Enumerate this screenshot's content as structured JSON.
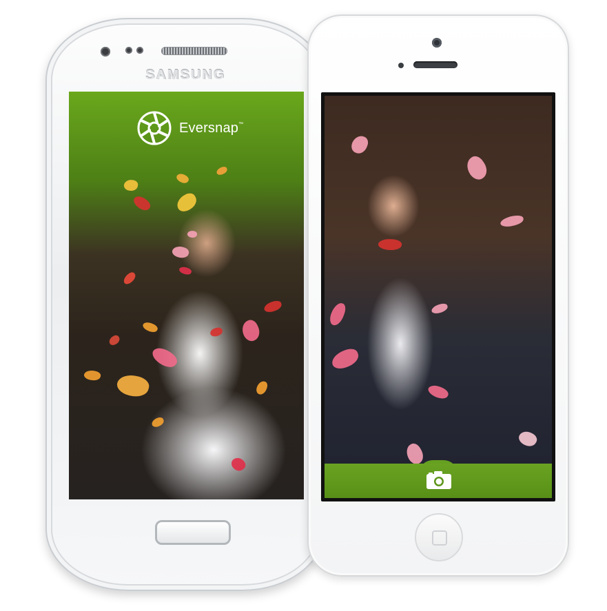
{
  "samsung_phone": {
    "brand_label": "SAMSUNG"
  },
  "android_app": {
    "logo_text": "Eversnap",
    "logo_trademark": "™"
  },
  "ios_app": {
    "camera_icon": "camera-icon"
  },
  "colors": {
    "accent_green": "#6aa322",
    "petal_pink": "#f06a8a",
    "petal_red": "#d6322f",
    "petal_orange": "#f2a030"
  }
}
